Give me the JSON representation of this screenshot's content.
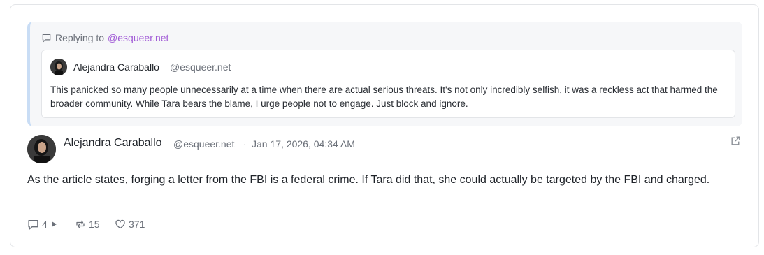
{
  "reply": {
    "prefix": "Replying to",
    "handle": "@esqueer.net"
  },
  "quoted": {
    "author": "Alejandra Caraballo",
    "handle": "@esqueer.net",
    "text": "This panicked so many people unnecessarily at a time when there are actual serious threats. It's not only incredibly selfish, it was a reckless act that harmed the broader community. While Tara bears the blame, I urge people not to engage. Just block and ignore."
  },
  "post": {
    "author": "Alejandra Caraballo",
    "handle": "@esqueer.net",
    "separator": "·",
    "timestamp": "Jan 17, 2026, 04:34 AM",
    "text": "As the article states, forging a letter from the FBI is a federal crime. If Tara did that, she could actually be targeted by the FBI and charged."
  },
  "actions": {
    "replies": "4",
    "reposts": "15",
    "likes": "371"
  },
  "icons": {
    "reply": "speech-bubble-icon",
    "expand": "play-triangle-icon",
    "repost": "repost-arrows-icon",
    "like": "heart-icon",
    "external": "external-link-icon"
  },
  "colors": {
    "accent_handle": "#a15bd6",
    "quote_bar": "#c9ddf5"
  }
}
